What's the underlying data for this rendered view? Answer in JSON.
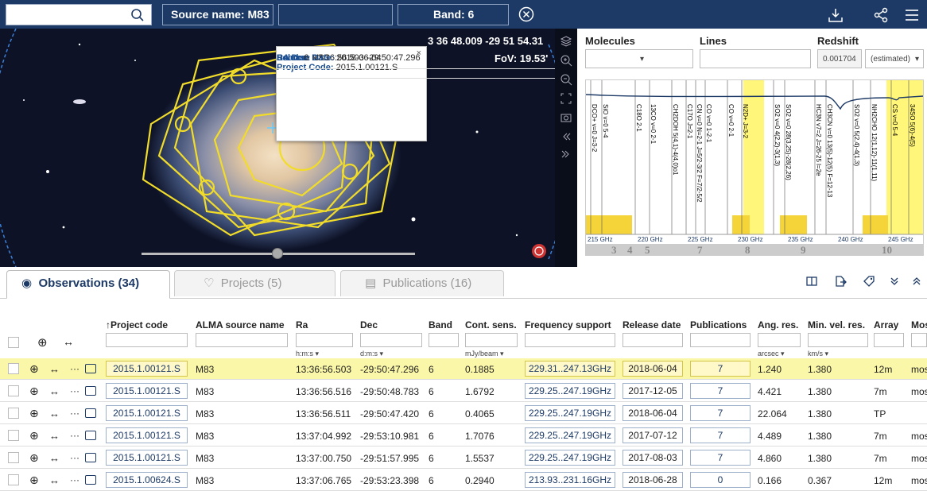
{
  "toolbar": {
    "search_value": "",
    "chips": [
      "Source name: M83",
      "",
      "Band: 6"
    ]
  },
  "sky": {
    "coords": "3 36 48.009 -29 51 54.31",
    "fov": "FoV: 19.53'"
  },
  "popup": {
    "project_code_label": "Project Code:",
    "project_code": "2015.1.00121.S",
    "source_label": "Source:",
    "source": "M83",
    "radec_label": "RA Dec:",
    "radec": "13:36:56.503 -29:50:47.296",
    "release_label": "Release Date:",
    "release": "2018-06-04",
    "band_label": "Band:",
    "band": "6"
  },
  "spectrum": {
    "molecules_label": "Molecules",
    "lines_label": "Lines",
    "redshift_label": "Redshift",
    "redshift_value": "0.001704",
    "redshift_mode": "(estimated)",
    "freq_ticks": [
      "215 GHz",
      "220 GHz",
      "225 GHz",
      "230 GHz",
      "235 GHz",
      "240 GHz",
      "245 GHz"
    ],
    "bands": [
      "3",
      "4",
      "5",
      "7",
      "8",
      "9",
      "10"
    ],
    "lines": [
      "DCO+ v=0 J=3-2",
      "SiO v=0 5-4",
      "C18O 2-1",
      "13CO v=0 2-1",
      "CH2DOH 5(4,1)-4(4,0)o1",
      "C17O J=2-1",
      "CN v=0 N=2-1 J=5/2-3/2 F=7/2-5/2",
      "CO v=0 1-2-1",
      "CO v=0 2-1",
      "N2D+ J=3-2",
      "SO2 v=0 4(2,2)-3(1,3)",
      "SO2 v=0 28(3,25)-28(2,26)",
      "HC3N v7=2 J=26-25 l=2e",
      "CH3CN v=0 13(5)-12(5) F=12-13",
      "SO2 v=0 5(2,4)-4(1,3)",
      "NH2CHO 12(1,12)-11(1,11)",
      "CS v=0 5-4",
      "34SO 5(6)-4(5)"
    ]
  },
  "tabs": [
    {
      "label": "Observations (34)"
    },
    {
      "label": "Projects (5)"
    },
    {
      "label": "Publications (16)"
    }
  ],
  "table": {
    "columns": [
      "↑Project code",
      "ALMA source name",
      "Ra",
      "Dec",
      "Band",
      "Cont. sens.",
      "Frequency support",
      "Release date",
      "Publications",
      "Ang. res.",
      "Min. vel. res.",
      "Array",
      "Mos"
    ],
    "units": {
      "ra": "h:m:s ▾",
      "dec": "d:m:s ▾",
      "sens": "mJy/beam ▾",
      "ang": "arcsec ▾",
      "vel": "km/s ▾"
    },
    "rows": [
      {
        "code": "2015.1.00121.S",
        "source": "M83",
        "ra": "13:36:56.503",
        "dec": "-29:50:47.296",
        "band": "6",
        "sens": "0.1885",
        "freq": "229.31..247.13GHz",
        "release": "2018-06-04",
        "pubs": "7",
        "ang": "1.240",
        "vel": "1.380",
        "array": "12m",
        "mos": "mos"
      },
      {
        "code": "2015.1.00121.S",
        "source": "M83",
        "ra": "13:36:56.516",
        "dec": "-29:50:48.783",
        "band": "6",
        "sens": "1.6792",
        "freq": "229.25..247.19GHz",
        "release": "2017-12-05",
        "pubs": "7",
        "ang": "4.421",
        "vel": "1.380",
        "array": "7m",
        "mos": "mos"
      },
      {
        "code": "2015.1.00121.S",
        "source": "M83",
        "ra": "13:36:56.511",
        "dec": "-29:50:47.420",
        "band": "6",
        "sens": "0.4065",
        "freq": "229.25..247.19GHz",
        "release": "2018-06-04",
        "pubs": "7",
        "ang": "22.064",
        "vel": "1.380",
        "array": "TP",
        "mos": ""
      },
      {
        "code": "2015.1.00121.S",
        "source": "M83",
        "ra": "13:37:04.992",
        "dec": "-29:53:10.981",
        "band": "6",
        "sens": "1.7076",
        "freq": "229.25..247.19GHz",
        "release": "2017-07-12",
        "pubs": "7",
        "ang": "4.489",
        "vel": "1.380",
        "array": "7m",
        "mos": "mos"
      },
      {
        "code": "2015.1.00121.S",
        "source": "M83",
        "ra": "13:37:00.750",
        "dec": "-29:51:57.995",
        "band": "6",
        "sens": "1.5537",
        "freq": "229.25..247.19GHz",
        "release": "2017-08-03",
        "pubs": "7",
        "ang": "4.860",
        "vel": "1.380",
        "array": "7m",
        "mos": "mos"
      },
      {
        "code": "2015.1.00624.S",
        "source": "M83",
        "ra": "13:37:06.765",
        "dec": "-29:53:23.398",
        "band": "6",
        "sens": "0.2940",
        "freq": "213.93..231.16GHz",
        "release": "2018-06-28",
        "pubs": "0",
        "ang": "0.166",
        "vel": "0.367",
        "array": "12m",
        "mos": "mos"
      }
    ]
  }
}
